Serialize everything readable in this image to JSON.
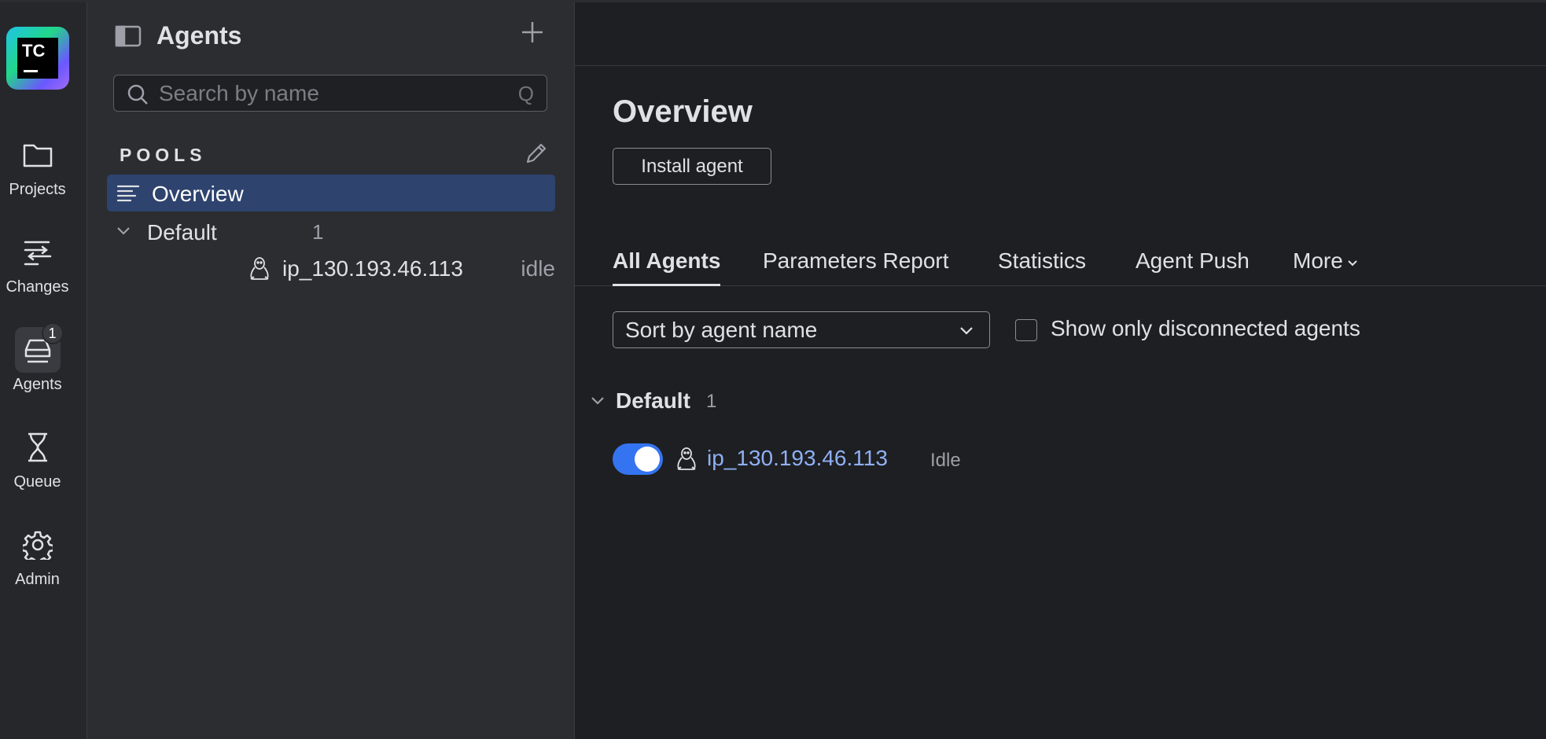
{
  "app": {
    "logo_text": "TC",
    "colors": {
      "accent": "#3574f0",
      "selection": "#2e436e",
      "link": "#8fb0f5"
    }
  },
  "rail": {
    "items": [
      {
        "label": "Projects",
        "icon": "folder-icon"
      },
      {
        "label": "Changes",
        "icon": "changes-icon"
      },
      {
        "label": "Agents",
        "icon": "agents-icon",
        "badge": "1",
        "active": true
      },
      {
        "label": "Queue",
        "icon": "hourglass-icon"
      },
      {
        "label": "Admin",
        "icon": "gear-icon"
      }
    ]
  },
  "panel": {
    "title": "Agents",
    "search_placeholder": "Search by name",
    "search_shortcut": "Q",
    "pools_label": "POOLS",
    "tree": {
      "overview": "Overview",
      "pool": {
        "name": "Default",
        "count": "1"
      },
      "agent": {
        "name": "ip_130.193.46.113",
        "status": "idle"
      }
    }
  },
  "main": {
    "title": "Overview",
    "install_button": "Install agent",
    "tabs": [
      {
        "label": "All Agents",
        "active": true
      },
      {
        "label": "Parameters Report"
      },
      {
        "label": "Statistics"
      },
      {
        "label": "Agent Push"
      },
      {
        "label": "More"
      }
    ],
    "sort_value": "Sort by agent name",
    "checkbox_label": "Show only disconnected agents",
    "group": {
      "name": "Default",
      "count": "1"
    },
    "agent": {
      "name": "ip_130.193.46.113",
      "status": "Idle",
      "enabled": true
    }
  }
}
